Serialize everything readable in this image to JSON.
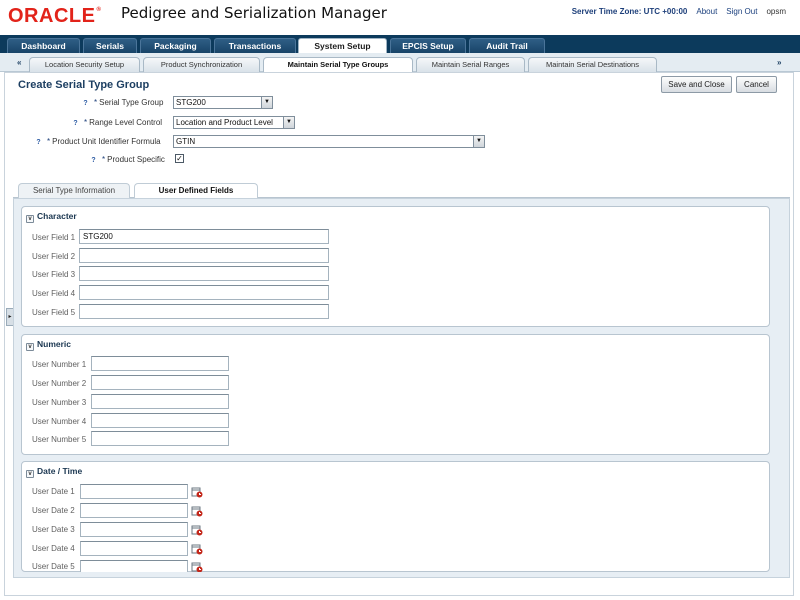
{
  "header": {
    "logo": "ORACLE",
    "logo_mark": "®",
    "title": "Pedigree and Serialization Manager",
    "server_time": "Server Time Zone: UTC +00:00",
    "about": "About",
    "sign_out": "Sign Out",
    "user": "opsm"
  },
  "topnav": {
    "tabs": [
      {
        "label": "Dashboard"
      },
      {
        "label": "Serials"
      },
      {
        "label": "Packaging"
      },
      {
        "label": "Transactions"
      },
      {
        "label": "System Setup"
      },
      {
        "label": "EPCIS Setup"
      },
      {
        "label": "Audit Trail"
      }
    ],
    "active": "System Setup"
  },
  "subnav": {
    "left_arrow": "«",
    "right_arrow": "»",
    "tabs": [
      {
        "label": "Location Security Setup"
      },
      {
        "label": "Product Synchronization"
      },
      {
        "label": "Maintain Serial Type Groups"
      },
      {
        "label": "Maintain Serial Ranges"
      },
      {
        "label": "Maintain Serial Destinations"
      }
    ],
    "active": "Maintain Serial Type Groups"
  },
  "page": {
    "title": "Create Serial Type Group",
    "save_close": "Save and Close",
    "cancel": "Cancel"
  },
  "form": {
    "help_glyph": "?",
    "required": "*",
    "serial_type_group": {
      "label": "Serial Type Group",
      "value": "STG200"
    },
    "range_level_control": {
      "label": "Range Level Control",
      "value": "Location and Product Level"
    },
    "product_unit_identifier_formula": {
      "label": "Product Unit Identifier Formula",
      "value": "GTIN"
    },
    "product_specific": {
      "label": "Product Specific",
      "checked": true,
      "mark": "✓"
    }
  },
  "inner_tabs": {
    "tabs": [
      {
        "label": "Serial Type Information"
      },
      {
        "label": "User Defined Fields"
      }
    ],
    "active": "User Defined Fields"
  },
  "character": {
    "title": "Character",
    "fields": [
      {
        "label": "User Field 1",
        "value": "STG200"
      },
      {
        "label": "User Field 2",
        "value": ""
      },
      {
        "label": "User Field 3",
        "value": ""
      },
      {
        "label": "User Field 4",
        "value": ""
      },
      {
        "label": "User Field 5",
        "value": ""
      }
    ]
  },
  "numeric": {
    "title": "Numeric",
    "fields": [
      {
        "label": "User Number 1",
        "value": ""
      },
      {
        "label": "User Number 2",
        "value": ""
      },
      {
        "label": "User Number 3",
        "value": ""
      },
      {
        "label": "User Number 4",
        "value": ""
      },
      {
        "label": "User Number 5",
        "value": ""
      }
    ]
  },
  "datetime": {
    "title": "Date / Time",
    "fields": [
      {
        "label": "User Date 1",
        "value": ""
      },
      {
        "label": "User Date 2",
        "value": ""
      },
      {
        "label": "User Date 3",
        "value": ""
      },
      {
        "label": "User Date 4",
        "value": ""
      },
      {
        "label": "User Date 5",
        "value": ""
      }
    ]
  },
  "glyphs": {
    "toggle": "v",
    "dropdown": "▼",
    "side_handle": "▸"
  },
  "colors": {
    "topnav_bg": "#0c3a5c",
    "brand_red": "#e2231a",
    "title_blue": "#1d3f62"
  }
}
